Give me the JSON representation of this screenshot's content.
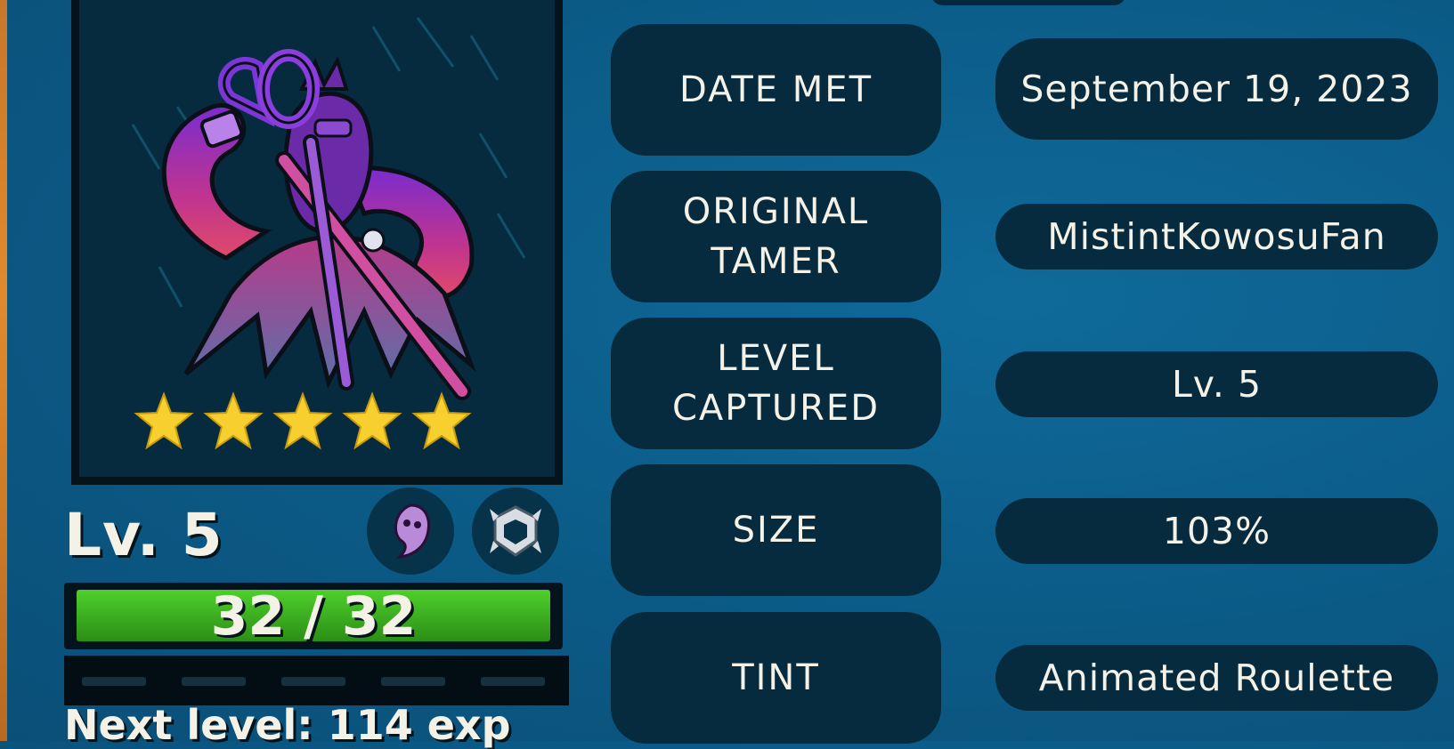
{
  "creature": {
    "stars": 5,
    "level_label": "Lv. 5",
    "badges": [
      "ghost-type-icon",
      "shield-type-icon"
    ],
    "hp": {
      "current": 32,
      "max": 32,
      "text": "32 / 32"
    },
    "next_level_text": "Next level: 114 exp"
  },
  "info": [
    {
      "label_lines": [
        "DATE MET"
      ],
      "value": "September 19, 2023"
    },
    {
      "label_lines": [
        "ORIGINAL",
        "TAMER"
      ],
      "value": "MistintKowosuFan"
    },
    {
      "label_lines": [
        "LEVEL",
        "CAPTURED"
      ],
      "value": "Lv. 5"
    },
    {
      "label_lines": [
        "SIZE"
      ],
      "value": "103%"
    },
    {
      "label_lines": [
        "TINT"
      ],
      "value": "Animated Roulette"
    }
  ],
  "colors": {
    "star": "#f7cf2e",
    "hp_bar": "#3fb324",
    "panel": "#062b3f",
    "background": "#0b5a86"
  }
}
